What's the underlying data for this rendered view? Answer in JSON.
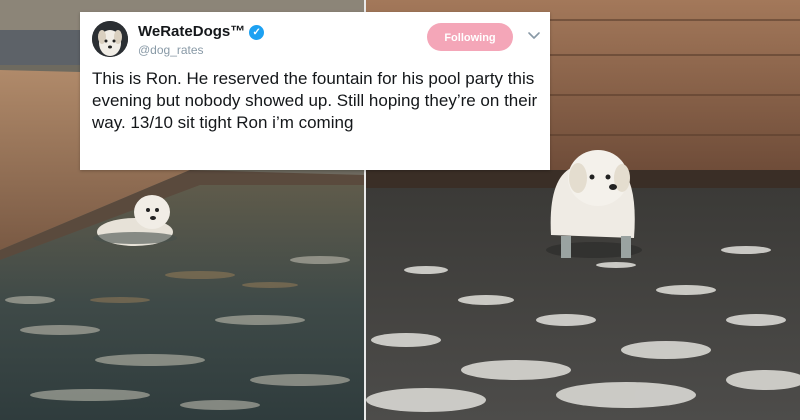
{
  "tweet": {
    "display_name": "WeRateDogs™",
    "handle": "@dog_rates",
    "follow_label": "Following",
    "text": "This is Ron. He reserved the fountain for his pool party this evening but nobody showed up. Still hoping they’re on their way. 13/10 sit tight Ron i’m coming",
    "verified_icon": "verified-badge-icon",
    "menu_icon": "chevron-down-icon"
  },
  "colors": {
    "follow_button": "#f4a6b8",
    "verified": "#1da1f2",
    "text": "#14171a",
    "handle": "#8899a6"
  }
}
